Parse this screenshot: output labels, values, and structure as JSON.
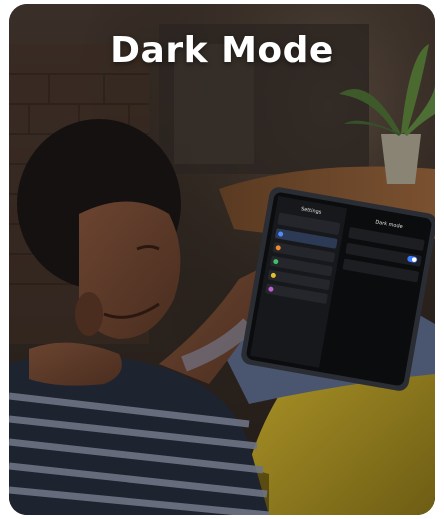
{
  "banner": {
    "title": "Dark Mode"
  },
  "tablet": {
    "screen_left_title": "Settings",
    "screen_right_title": "Dark mode"
  }
}
